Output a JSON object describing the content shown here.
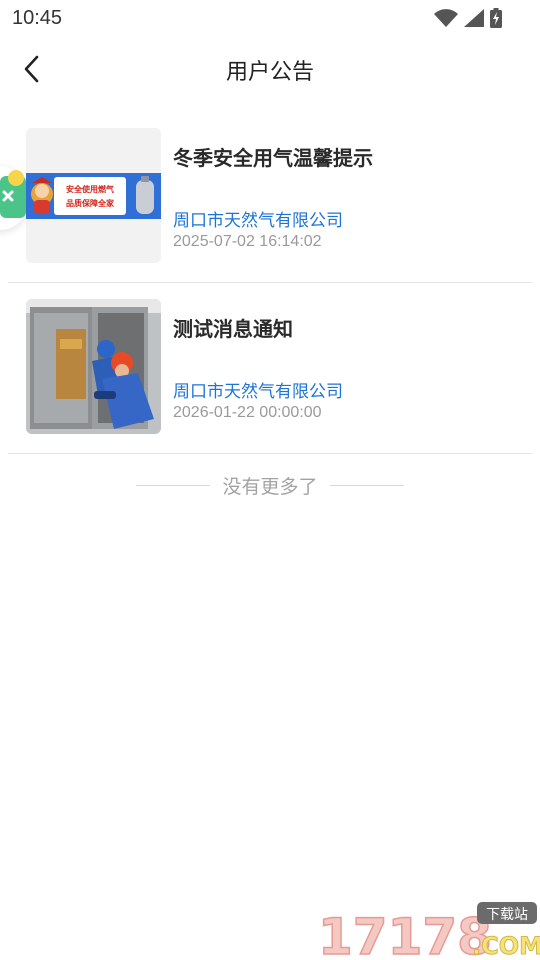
{
  "status_bar": {
    "time": "10:45",
    "icons": [
      "wifi-icon",
      "signal-icon",
      "battery-charging-icon"
    ]
  },
  "header": {
    "title": "用户公告",
    "back_icon": "chevron-left-icon"
  },
  "announcements": [
    {
      "title": "冬季安全用气温馨提示",
      "company": "周口市天然气有限公司",
      "time": "2025-07-02 16:14:02",
      "thumbnail": {
        "kind": "banner",
        "line1": "安全使用燃气",
        "line2": "品质保障全家"
      }
    },
    {
      "title": "测试消息通知",
      "company": "周口市天然气有限公司",
      "time": "2026-01-22 00:00:00",
      "thumbnail": {
        "kind": "photo"
      }
    }
  ],
  "footer": {
    "no_more_text": "没有更多了"
  },
  "watermark": {
    "brand": "17178",
    "domain": ".COM",
    "tag": "下载站"
  },
  "colors": {
    "accent_blue": "#1e73d8",
    "time_gray": "#9a9a9a",
    "divider": "#e6e6e6"
  }
}
